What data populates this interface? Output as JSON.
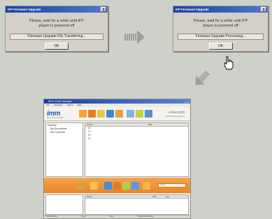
{
  "dialog_transferring": {
    "title": "iFP Firmware Upgrade",
    "close_glyph": "x",
    "message_line1": "Please, wait for a while until iFP",
    "message_line2": "player is powered off",
    "status": "Firmware Upgrade File Transferring...",
    "ok_label": "OK"
  },
  "dialog_processing": {
    "title": "iFP Firmware Upgrade",
    "close_glyph": "x",
    "message_line1": "Please, wait for a while until iFP",
    "message_line2": "player is powered off",
    "status": "Firmware Upgrade Processing...",
    "ok_label": "OK"
  },
  "app": {
    "title": "iRiver Music Manager",
    "window_controls": "_ □ x",
    "menu": [
      "File",
      "Operation",
      "Option",
      "Help"
    ],
    "logo": "imm",
    "logo_sub": "iRiver Music Manager",
    "brand": "i.river.com",
    "brand_sub": "Digital Audio Everywhere",
    "tree": [
      "Desktop",
      "My Documents",
      "My Computer"
    ],
    "upper_columns": {
      "name": "Name",
      "size": "Size"
    },
    "upper_files": [
      "A:\\",
      "C:\\",
      "D:\\",
      "E:\\"
    ],
    "search_placeholder": "Search",
    "lower_columns": {
      "name": "Name",
      "size": "Size",
      "type": "Type"
    },
    "status": [
      "Total Capacity",
      "Used",
      "Free",
      "Remaining Capacity"
    ],
    "colors": {
      "toolbar_icons": [
        "#f0a63a",
        "#e37d24",
        "#f1c34a",
        "#3c88d6",
        "#e8a13a",
        "#7fb6e3",
        "#c8d23c",
        "#5a8fd0"
      ],
      "midbar_icons": [
        "#d9a23c",
        "#f5c450",
        "#3c8fd6",
        "#e07c2a",
        "#b2cf4a",
        "#5a9ad8",
        "#f2b548"
      ]
    }
  },
  "icons": {
    "arrow_right": "arrow-right-icon",
    "arrow_diag": "arrow-down-left-icon",
    "cursor": "hand-pointer-icon"
  }
}
